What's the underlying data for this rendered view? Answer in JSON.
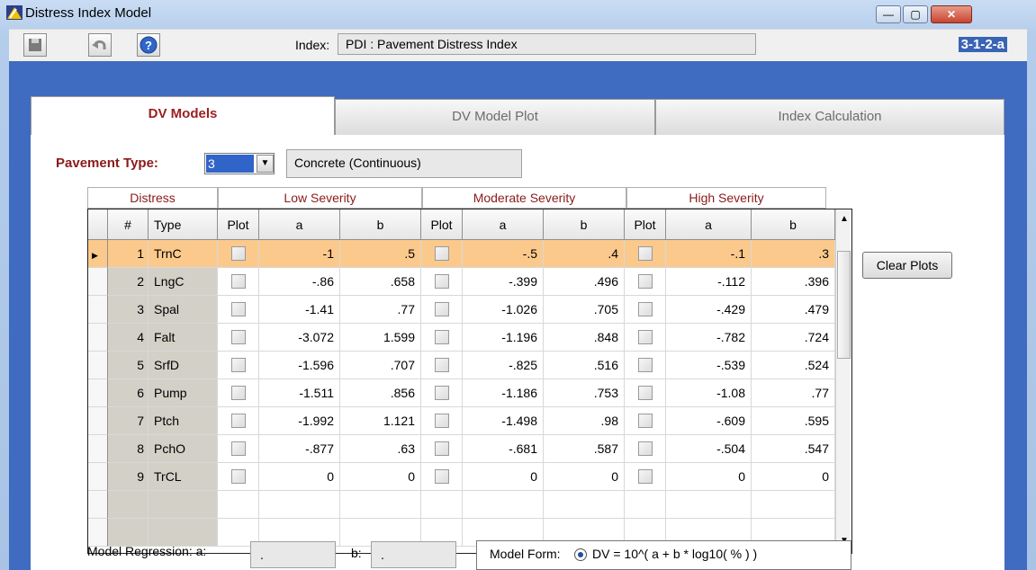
{
  "window": {
    "title": "Distress Index Model",
    "min": "—",
    "max": "▢",
    "close": "✕"
  },
  "toolbar": {
    "index_label": "Index:",
    "index_value": "PDI  :  Pavement Distress Index",
    "screen_id": "3-1-2-a"
  },
  "tabs": [
    {
      "label": "DV Models"
    },
    {
      "label": "DV Model Plot"
    },
    {
      "label": "Index Calculation"
    }
  ],
  "pavement": {
    "label": "Pavement Type:",
    "value": "3",
    "description": "Concrete (Continuous)"
  },
  "groups": {
    "distress": "Distress",
    "low": "Low Severity",
    "moderate": "Moderate Severity",
    "high": "High Severity"
  },
  "columns": {
    "num": "#",
    "type": "Type",
    "plot": "Plot",
    "a": "a",
    "b": "b"
  },
  "rows": [
    {
      "num": "1",
      "type": "TrnC",
      "la": "-1",
      "lb": ".5",
      "ma": "-.5",
      "mb": ".4",
      "ha": "-.1",
      "hb": ".3"
    },
    {
      "num": "2",
      "type": "LngC",
      "la": "-.86",
      "lb": ".658",
      "ma": "-.399",
      "mb": ".496",
      "ha": "-.112",
      "hb": ".396"
    },
    {
      "num": "3",
      "type": "Spal",
      "la": "-1.41",
      "lb": ".77",
      "ma": "-1.026",
      "mb": ".705",
      "ha": "-.429",
      "hb": ".479"
    },
    {
      "num": "4",
      "type": "Falt",
      "la": "-3.072",
      "lb": "1.599",
      "ma": "-1.196",
      "mb": ".848",
      "ha": "-.782",
      "hb": ".724"
    },
    {
      "num": "5",
      "type": "SrfD",
      "la": "-1.596",
      "lb": ".707",
      "ma": "-.825",
      "mb": ".516",
      "ha": "-.539",
      "hb": ".524"
    },
    {
      "num": "6",
      "type": "Pump",
      "la": "-1.511",
      "lb": ".856",
      "ma": "-1.186",
      "mb": ".753",
      "ha": "-1.08",
      "hb": ".77"
    },
    {
      "num": "7",
      "type": "Ptch",
      "la": "-1.992",
      "lb": "1.121",
      "ma": "-1.498",
      "mb": ".98",
      "ha": "-.609",
      "hb": ".595"
    },
    {
      "num": "8",
      "type": "PchO",
      "la": "-.877",
      "lb": ".63",
      "ma": "-.681",
      "mb": ".587",
      "ha": "-.504",
      "hb": ".547"
    },
    {
      "num": "9",
      "type": "TrCL",
      "la": "0",
      "lb": "0",
      "ma": "0",
      "mb": "0",
      "ha": "0",
      "hb": "0"
    }
  ],
  "clear_plots": "Clear Plots",
  "regression": {
    "label": "Model Regression:  a:",
    "a_value": ".",
    "b_label": "b:",
    "b_value": "."
  },
  "model_form": {
    "label": "Model Form:",
    "formula": "DV = 10^( a + b * log10( % ) )"
  },
  "colors": {
    "selected_row": "#fcc98c",
    "accent": "#8b1a1a",
    "panel": "#3f6bc0"
  }
}
